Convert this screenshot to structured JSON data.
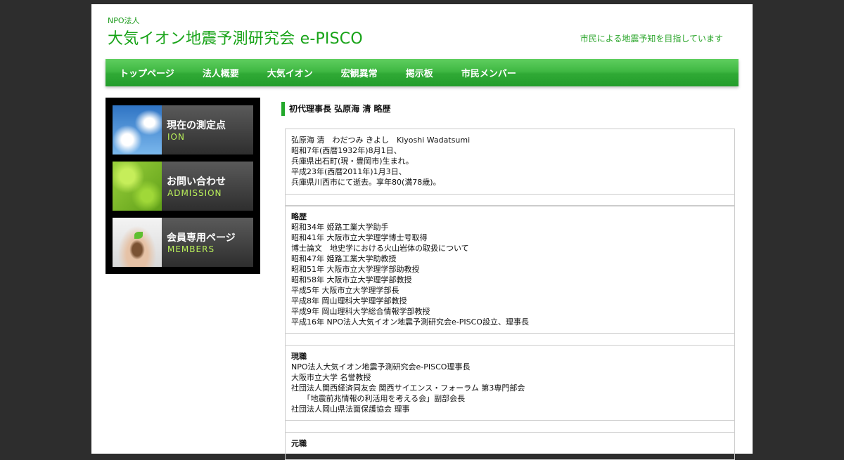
{
  "header": {
    "npo_label": "NPO法人",
    "site_title": "大気イオン地震予測研究会 e-PISCO",
    "tagline": "市民による地震予知を目指しています"
  },
  "nav": {
    "items": [
      {
        "label": "トップページ"
      },
      {
        "label": "法人概要"
      },
      {
        "label": "大気イオン"
      },
      {
        "label": "宏観異常"
      },
      {
        "label": "掲示板"
      },
      {
        "label": "市民メンバー"
      }
    ]
  },
  "sidebar": {
    "banners": [
      {
        "jp": "現在の測定点",
        "en": "ION"
      },
      {
        "jp": "お問い合わせ",
        "en": "ADMISSION"
      },
      {
        "jp": "会員専用ページ",
        "en": "MEMBERS"
      }
    ]
  },
  "main": {
    "title": "初代理事長 弘原海 清 略歴",
    "profile": [
      "弘原海 清　わだつみ きよし　Kiyoshi Wadatsumi",
      "昭和7年(西暦1932年)8月1日、",
      "兵庫県出石町(現・豊岡市)生まれ。",
      "平成23年(西暦2011年)1月3日、",
      "兵庫県川西市にて逝去。享年80(満78歳)。"
    ],
    "career_head": "略歴",
    "career": [
      "昭和34年 姫路工業大学助手",
      "昭和41年 大阪市立大学理学博士号取得",
      "博士論文　地史学における火山岩体の取扱について",
      "昭和47年 姫路工業大学助教授",
      "昭和51年 大阪市立大学理学部助教授",
      "昭和58年 大阪市立大学理学部教授",
      "平成5年 大阪市立大学理学部長",
      "平成8年 岡山理科大学理学部教授",
      "平成9年 岡山理科大学総合情報学部教授",
      "平成16年 NPO法人大気イオン地震予測研究会e-PISCO設立、理事長"
    ],
    "current_head": "現職",
    "current": [
      "NPO法人大気イオン地震予測研究会e-PISCO理事長",
      "大阪市立大学 名誉教授",
      "社団法人関西経済同友会 関西サイエンス・フォーラム 第3専門部会",
      "　　「地震前兆情報の利活用を考える会」副部会長",
      "社団法人岡山県法面保護協会 理事"
    ],
    "next_head": "元職"
  }
}
